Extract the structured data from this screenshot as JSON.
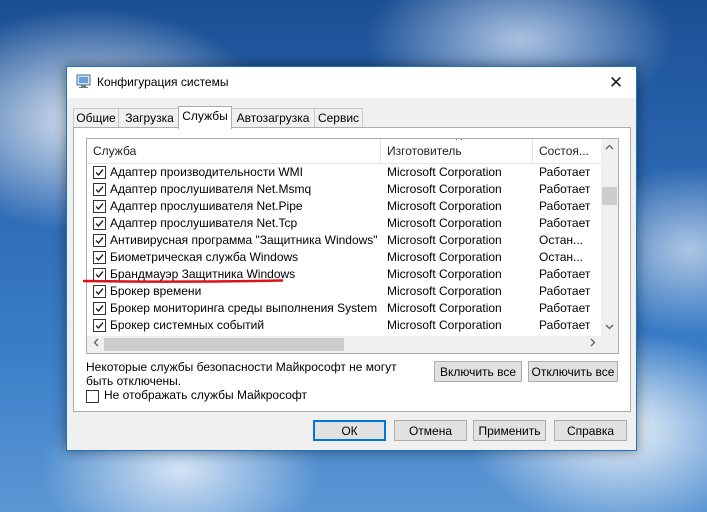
{
  "window": {
    "title": "Конфигурация системы",
    "close_glyph": "✕"
  },
  "tabs": [
    {
      "label": "Общие",
      "active": false
    },
    {
      "label": "Загрузка",
      "active": false
    },
    {
      "label": "Службы",
      "active": true
    },
    {
      "label": "Автозагрузка",
      "active": false
    },
    {
      "label": "Сервис",
      "active": false
    }
  ],
  "services_table": {
    "columns": [
      "Служба",
      "Изготовитель",
      "Состоя..."
    ],
    "rows": [
      {
        "name": "Адаптер производительности WMI",
        "maker": "Microsoft Corporation",
        "status": "Работает",
        "checked": true
      },
      {
        "name": "Адаптер прослушивателя Net.Msmq",
        "maker": "Microsoft Corporation",
        "status": "Работает",
        "checked": true
      },
      {
        "name": "Адаптер прослушивателя Net.Pipe",
        "maker": "Microsoft Corporation",
        "status": "Работает",
        "checked": true
      },
      {
        "name": "Адаптер прослушивателя Net.Tcp",
        "maker": "Microsoft Corporation",
        "status": "Работает",
        "checked": true
      },
      {
        "name": "Антивирусная программа \"Защитника Windows\"",
        "maker": "Microsoft Corporation",
        "status": "Остан...",
        "checked": true
      },
      {
        "name": "Биометрическая служба Windows",
        "maker": "Microsoft Corporation",
        "status": "Остан...",
        "checked": true
      },
      {
        "name": "Брандмауэр Защитника Windows",
        "maker": "Microsoft Corporation",
        "status": "Работает",
        "checked": true
      },
      {
        "name": "Брокер времени",
        "maker": "Microsoft Corporation",
        "status": "Работает",
        "checked": true
      },
      {
        "name": "Брокер мониторинга среды выполнения System G...",
        "maker": "Microsoft Corporation",
        "status": "Работает",
        "checked": true
      },
      {
        "name": "Брокер системных событий",
        "maker": "Microsoft Corporation",
        "status": "Работает",
        "checked": true
      }
    ]
  },
  "note": "Некоторые службы безопасности Майкрософт не могут быть отключены.",
  "buttons": {
    "enable_all": "Включить все",
    "disable_all": "Отключить все",
    "ok": "ОК",
    "cancel": "Отмена",
    "apply": "Применить",
    "help": "Справка"
  },
  "hide_ms_services": {
    "label": "Не отображать службы Майкрософт",
    "checked": false
  },
  "colors": {
    "highlight_underline": "#d9141a",
    "accent": "#0078d7"
  }
}
